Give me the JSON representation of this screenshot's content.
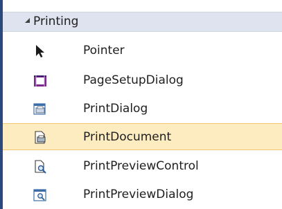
{
  "toolbox": {
    "group": {
      "label": "Printing",
      "expanded": true
    },
    "items": [
      {
        "label": "Pointer",
        "icon": "pointer-arrow-icon",
        "selected": false
      },
      {
        "label": "PageSetupDialog",
        "icon": "page-setup-dialog-icon",
        "selected": false
      },
      {
        "label": "PrintDialog",
        "icon": "print-dialog-icon",
        "selected": false
      },
      {
        "label": "PrintDocument",
        "icon": "print-document-icon",
        "selected": true
      },
      {
        "label": "PrintPreviewControl",
        "icon": "print-preview-control-icon",
        "selected": false
      },
      {
        "label": "PrintPreviewDialog",
        "icon": "print-preview-dialog-icon",
        "selected": false
      }
    ]
  },
  "colors": {
    "selection_background": "#fdecc0",
    "selection_border": "#f0c76c",
    "group_header_background": "#dfe3ef",
    "window_edge": "#2b4a7b"
  }
}
